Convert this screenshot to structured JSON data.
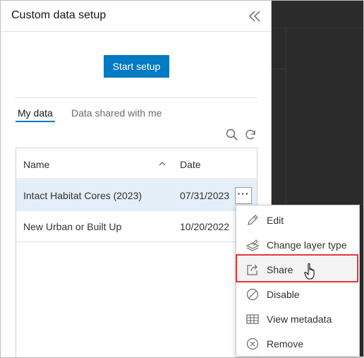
{
  "panel": {
    "title": "Custom data setup",
    "start_button": "Start setup"
  },
  "tabs": [
    {
      "label": "My data",
      "active": true
    },
    {
      "label": "Data shared with me",
      "active": false
    }
  ],
  "table": {
    "columns": [
      "Name",
      "Date"
    ],
    "rows": [
      {
        "name": "Intact Habitat Cores (2023)",
        "date": "07/31/2023",
        "selected": true
      },
      {
        "name": "New Urban or Built Up",
        "date": "10/20/2022",
        "selected": false
      }
    ]
  },
  "menu": {
    "items": [
      {
        "label": "Edit",
        "icon": "pencil-icon"
      },
      {
        "label": "Change layer type",
        "icon": "layers-icon"
      },
      {
        "label": "Share",
        "icon": "share-icon",
        "highlighted": true
      },
      {
        "label": "Disable",
        "icon": "disable-icon"
      },
      {
        "label": "View metadata",
        "icon": "table-icon"
      },
      {
        "label": "Remove",
        "icon": "remove-icon"
      }
    ]
  },
  "colors": {
    "accent": "#007ac2",
    "selected_row": "#e3eef8",
    "highlight_box": "#e0363b",
    "map_background": "#2b2b2b"
  }
}
